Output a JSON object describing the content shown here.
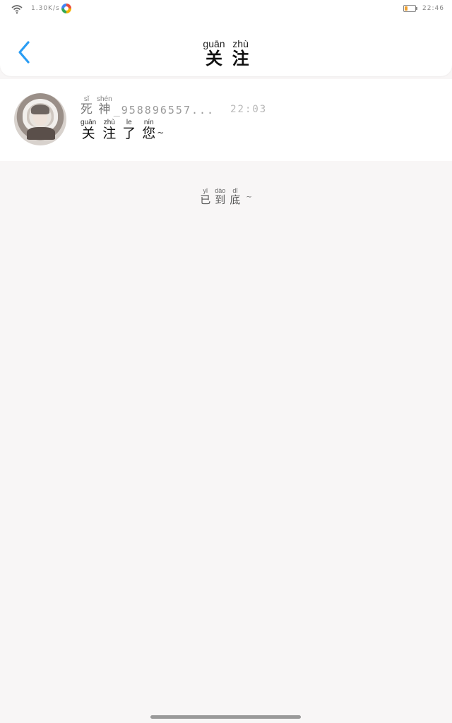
{
  "status_bar": {
    "network_speed": "1.30K/s",
    "time": "22:46",
    "battery_level": 0.25,
    "wifi_icon": "wifi-icon",
    "app_icon": "colorful-app-icon"
  },
  "header": {
    "title_pinyin": [
      "guān",
      "zhù"
    ],
    "title_hanzi": [
      "关",
      "注"
    ],
    "back_icon": "chevron-left-icon",
    "accent_color": "#2a9df4"
  },
  "notifications": [
    {
      "avatar_icon": "anime-avatar",
      "username_pinyin": [
        "sǐ",
        "shén"
      ],
      "username_hanzi": [
        "死",
        "神"
      ],
      "username_rest": "_958896557...",
      "time": "22:03",
      "message_pinyin": [
        "guān",
        "zhù",
        "le",
        "nín"
      ],
      "message_hanzi": [
        "关",
        "注",
        "了",
        "您"
      ],
      "message_suffix": "~"
    }
  ],
  "end_note": {
    "pinyin": [
      "yǐ",
      "dào",
      "dǐ"
    ],
    "hanzi": [
      "已",
      "到",
      "底"
    ],
    "suffix": "~"
  }
}
